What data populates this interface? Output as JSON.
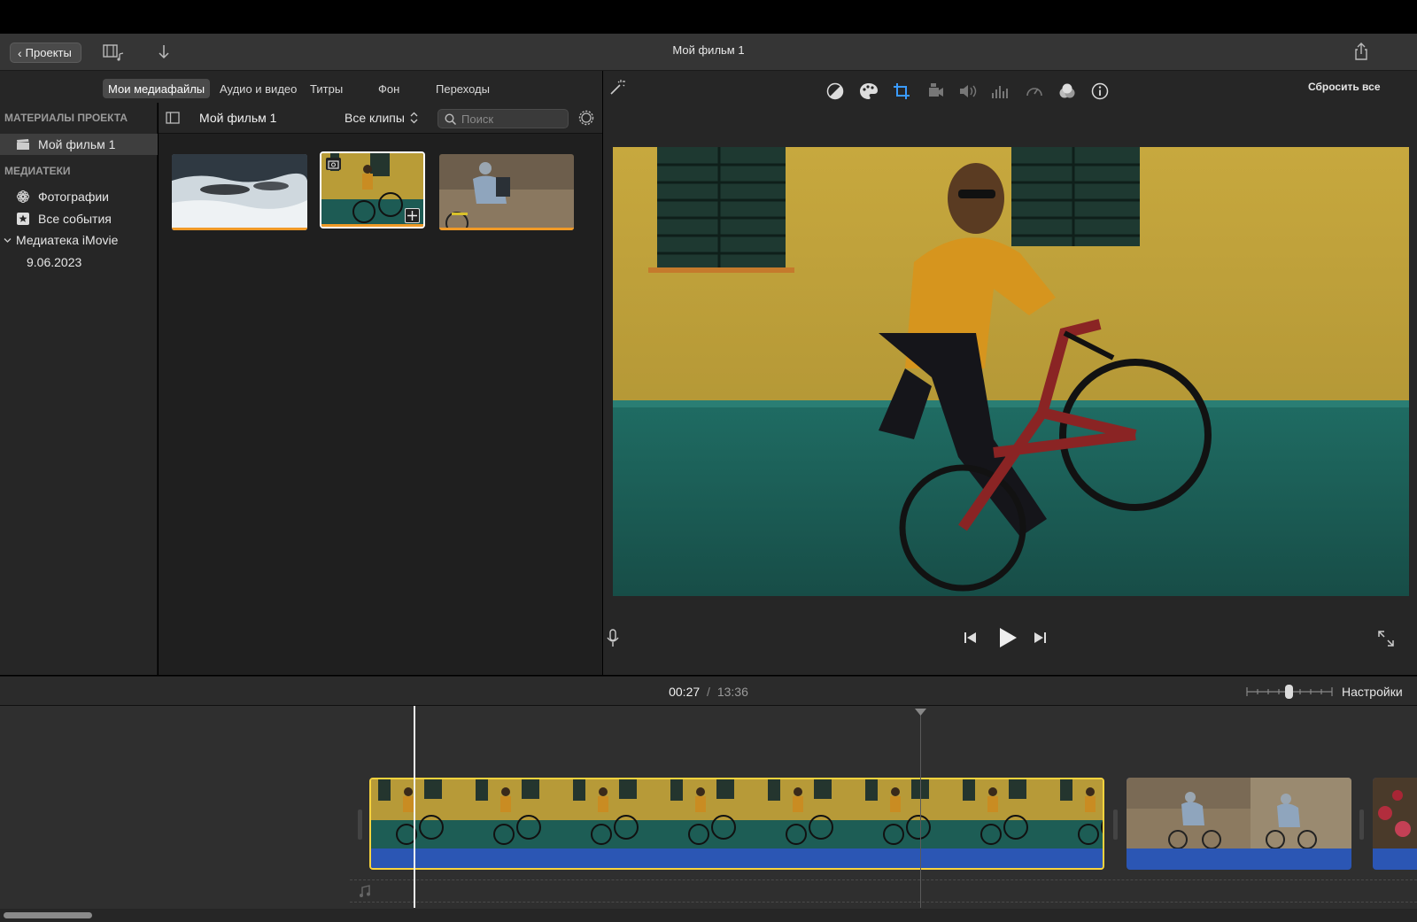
{
  "toolbar": {
    "projects_label": "Проекты",
    "movie_title": "Мой фильм 1"
  },
  "browser_tabs": [
    {
      "label": "Мои медиафайлы",
      "active": true
    },
    {
      "label": "Аудио и видео",
      "active": false
    },
    {
      "label": "Титры",
      "active": false
    },
    {
      "label": "Фон",
      "active": false
    },
    {
      "label": "Переходы",
      "active": false
    }
  ],
  "sidebar": {
    "project_header": "МАТЕРИАЛЫ ПРОЕКТА",
    "project_item": "Мой фильм 1",
    "libraries_header": "МЕДИАТЕКИ",
    "photos": "Фотографии",
    "all_events": "Все события",
    "library": "Медиатека iMovie",
    "event": "9.06.2023"
  },
  "browser": {
    "title": "Мой фильм 1",
    "filter": "Все клипы",
    "search_placeholder": "Поиск"
  },
  "viewer": {
    "reset_all": "Сбросить все"
  },
  "timeline": {
    "current_time": "00:27",
    "separator": "/",
    "total_time": "13:36",
    "settings_label": "Настройки"
  },
  "colors": {
    "accent": "#f7d33d",
    "progress": "#f09a27",
    "audio": "#2b56b4",
    "crop_active": "#3a9bff"
  }
}
